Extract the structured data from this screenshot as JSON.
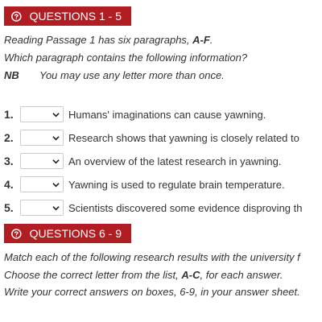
{
  "section1": {
    "title": "QUESTIONS 1 - 5",
    "instructions": {
      "line1_prefix": "Reading Passage 1 has six paragraphs, ",
      "line1_bold": "A-F",
      "line1_suffix": ".",
      "line2": "Which paragraph contains the following information?",
      "nb_label": "NB",
      "nb_text": "You may use any letter more than once."
    },
    "questions": [
      {
        "number": "1.",
        "text": "Humans' imaginations can cause yawning."
      },
      {
        "number": "2.",
        "text": "Research shows that yawning is closely related to"
      },
      {
        "number": "3.",
        "text": "An overview of the latest research in yawning."
      },
      {
        "number": "4.",
        "text": "Yawning is used to regulate brain temperature."
      },
      {
        "number": "5.",
        "text": "Scientists discovered some evidence disproving th"
      }
    ]
  },
  "section2": {
    "title": "QUESTIONS 6 - 9",
    "instructions": {
      "line1": "Match each of the following research results with the university f",
      "line2_prefix": "Choose the correct letter from the list, ",
      "line2_bold": "A-C",
      "line2_suffix": ", for each answer.",
      "line3": "Write your correct answers on boxes, 6-9, in your answer sheet."
    }
  },
  "colors": {
    "header_bg": "#b01e23",
    "header_text": "#ffffff",
    "body_text": "#333333"
  },
  "icons": {
    "header": "help-circle-icon",
    "select": "chevron-down-icon"
  }
}
